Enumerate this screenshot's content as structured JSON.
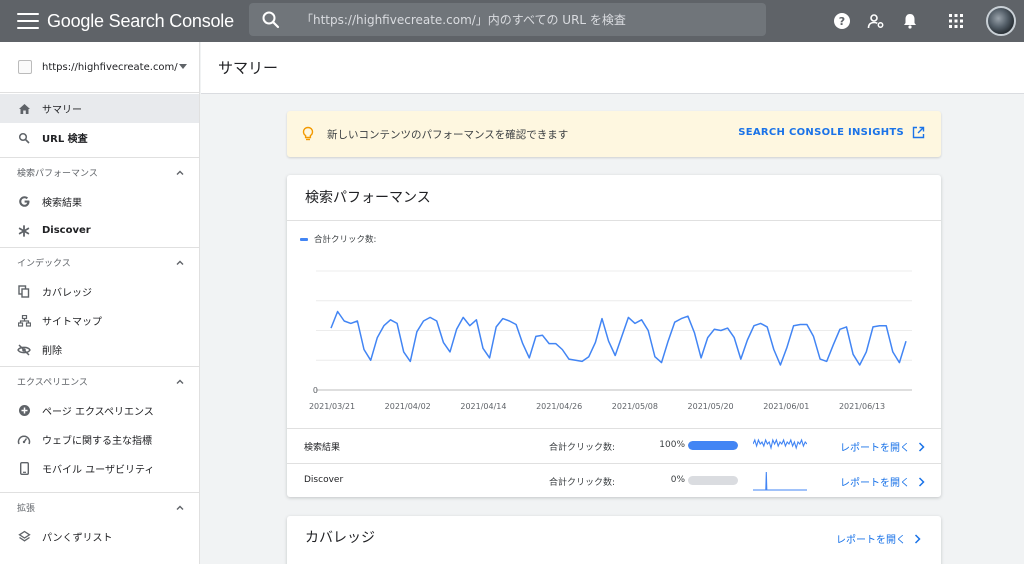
{
  "topbar": {
    "logo": "Google Search Console",
    "search_placeholder": "「https://highfivecreate.com/」内のすべての URL を検査",
    "icons": [
      "menu-icon",
      "search-icon",
      "help-icon",
      "manage-accounts-icon",
      "notifications-icon",
      "apps-icon"
    ]
  },
  "sidebar": {
    "property": "https://highfivecreate.com/",
    "top_items": [
      {
        "label": "サマリー",
        "icon": "home-icon",
        "active": true
      },
      {
        "label": "URL 検査",
        "icon": "search-icon"
      }
    ],
    "sections": [
      {
        "title": "検索パフォーマンス",
        "items": [
          {
            "label": "検索結果",
            "icon": "google-g-icon"
          },
          {
            "label": "Discover",
            "icon": "asterisk-icon",
            "bold": true
          }
        ]
      },
      {
        "title": "インデックス",
        "items": [
          {
            "label": "カバレッジ",
            "icon": "copy-icon"
          },
          {
            "label": "サイトマップ",
            "icon": "sitemap-icon"
          },
          {
            "label": "削除",
            "icon": "visibility-off-icon"
          }
        ]
      },
      {
        "title": "エクスペリエンス",
        "items": [
          {
            "label": "ページ エクスペリエンス",
            "icon": "add-circle-icon"
          },
          {
            "label": "ウェブに関する主な指標",
            "icon": "speed-icon"
          },
          {
            "label": "モバイル ユーザビリティ",
            "icon": "smartphone-icon"
          }
        ]
      },
      {
        "title": "拡張",
        "items": [
          {
            "label": "パンくずリスト",
            "icon": "layers-icon"
          }
        ]
      }
    ]
  },
  "page": {
    "title": "サマリー"
  },
  "insight": {
    "text": "新しいコンテンツのパフォーマンスを確認できます",
    "link": "SEARCH CONSOLE INSIGHTS"
  },
  "performance": {
    "title": "検索パフォーマンス",
    "legend": "合計クリック数:",
    "rows": [
      {
        "name": "検索結果",
        "metric": "合計クリック数:",
        "pct": "100%",
        "fill": 1.0,
        "link": "レポートを開く"
      },
      {
        "name": "Discover",
        "metric": "合計クリック数:",
        "pct": "0%",
        "fill": 0.0,
        "link": "レポートを開く"
      }
    ]
  },
  "coverage": {
    "title": "カバレッジ",
    "link": "レポートを開く"
  },
  "chart_data": {
    "type": "line",
    "series": [
      {
        "values": [
          52,
          66,
          58,
          56,
          58,
          34,
          25,
          44,
          54,
          59,
          56,
          32,
          24,
          49,
          58,
          61,
          58,
          40,
          32,
          51,
          61,
          54,
          59,
          35,
          27,
          53,
          60,
          58,
          55,
          39,
          27,
          45,
          46,
          39,
          39,
          34,
          26,
          25,
          24,
          28,
          40,
          60,
          41,
          29,
          45,
          61,
          56,
          59,
          50,
          28,
          23,
          41,
          57,
          60,
          62,
          48,
          27,
          44,
          51,
          50,
          52,
          44,
          26,
          42,
          54,
          56,
          53,
          34,
          21,
          36,
          54,
          55,
          55,
          45,
          26,
          24,
          38,
          51,
          53,
          30,
          21,
          32,
          53,
          54,
          54,
          32,
          23,
          41
        ]
      }
    ],
    "x_ticks": [
      "2021/03/21",
      "2021/04/02",
      "2021/04/14",
      "2021/04/26",
      "2021/05/08",
      "2021/05/20",
      "2021/06/01",
      "2021/06/13"
    ],
    "y_ticks": [
      "0"
    ],
    "ylim": [
      0,
      100
    ],
    "grid": true,
    "color": "#4285f4"
  },
  "sparklines": {
    "search": [
      5,
      7,
      4,
      7,
      5,
      6,
      4,
      7,
      5,
      6,
      3,
      7,
      5,
      7,
      4,
      6,
      5,
      7,
      4,
      6,
      5,
      7,
      4,
      6,
      3,
      6,
      5,
      7,
      4,
      6,
      5
    ],
    "discover": [
      0,
      0,
      0,
      0,
      0,
      0,
      0,
      0,
      0,
      0,
      0,
      0,
      0,
      0,
      0,
      0,
      0,
      0,
      0,
      0,
      0,
      0,
      0,
      0,
      0,
      0,
      0,
      0,
      0,
      0,
      0,
      0,
      0,
      0,
      0,
      0,
      0,
      0,
      0,
      0,
      0,
      0,
      0,
      0,
      0,
      0,
      0,
      0,
      0,
      0,
      0,
      0,
      0,
      0,
      0,
      0,
      0,
      0,
      0,
      0,
      0,
      0,
      0,
      0,
      0,
      0,
      0,
      0,
      0,
      0,
      0,
      0,
      0,
      0,
      0,
      0,
      0,
      0,
      0,
      0,
      0,
      0,
      0,
      0,
      0,
      0,
      0,
      0,
      0,
      0
    ]
  },
  "colors": {
    "topbar": "#5f6368",
    "accent": "#1a73e8",
    "series": "#4285f4",
    "insight_bg": "#fef7e0"
  }
}
